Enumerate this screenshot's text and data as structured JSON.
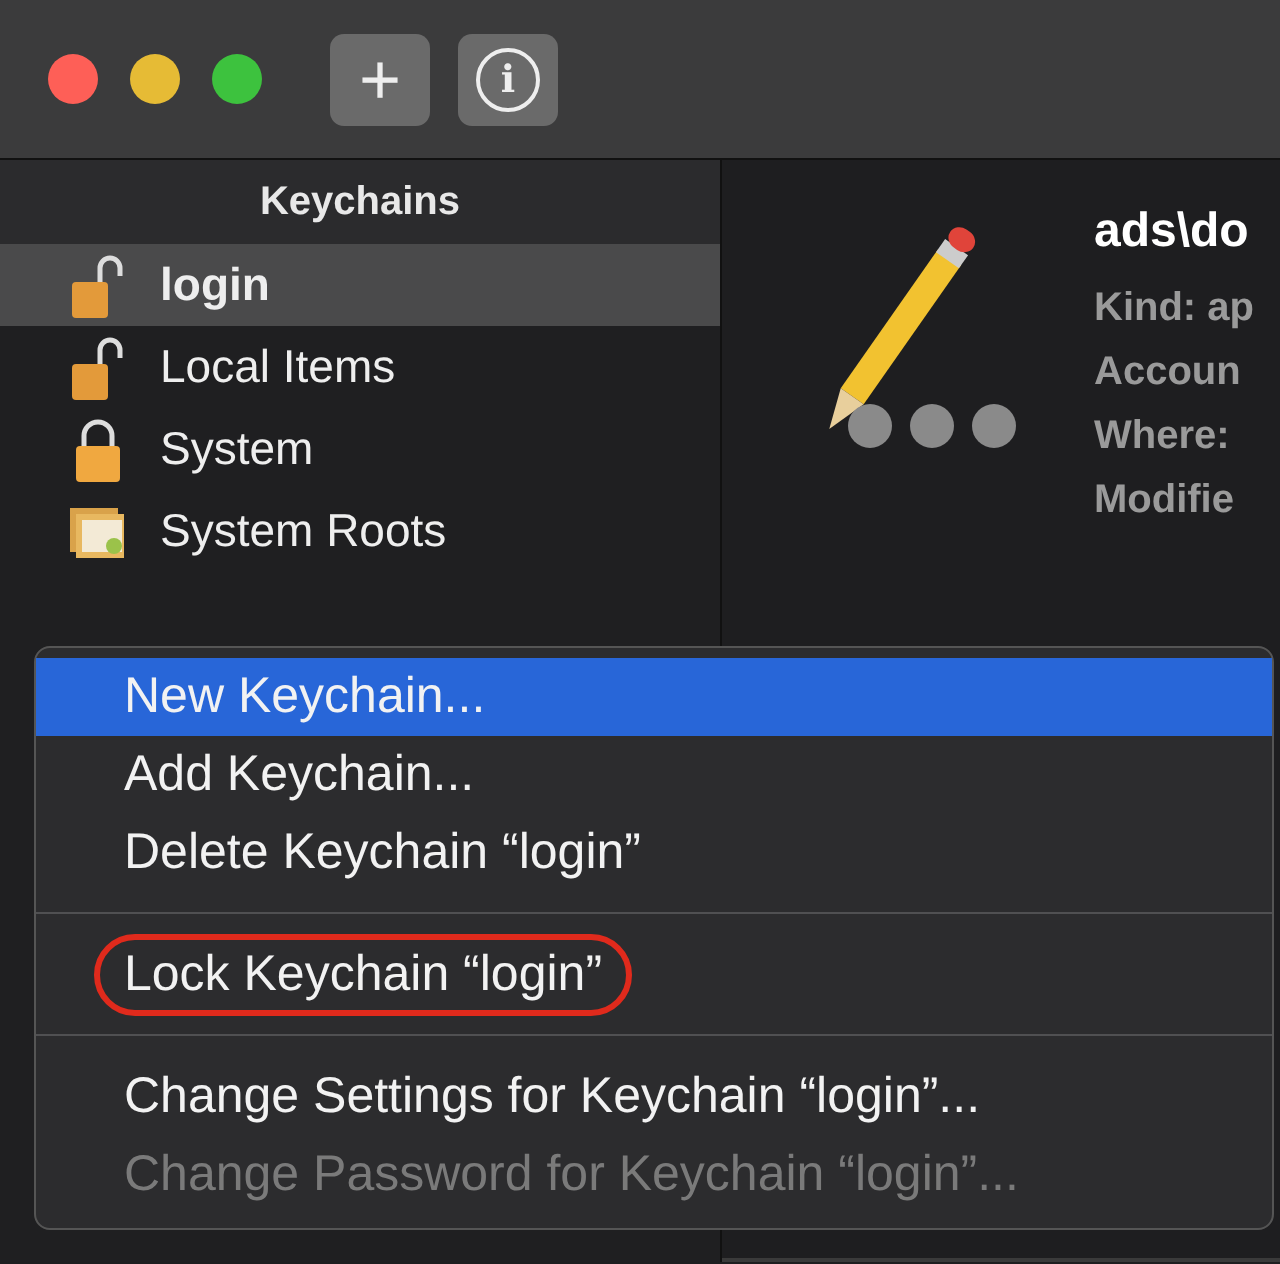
{
  "toolbar": {
    "buttons": [
      {
        "kind": "add",
        "label": "+"
      },
      {
        "kind": "info",
        "label": "i"
      }
    ]
  },
  "sidebar": {
    "header": "Keychains",
    "items": [
      {
        "label": "login",
        "kind": "unlocked",
        "selected": true
      },
      {
        "label": "Local Items",
        "kind": "unlocked",
        "selected": false
      },
      {
        "label": "System",
        "kind": "locked",
        "selected": false
      },
      {
        "label": "System Roots",
        "kind": "certificate",
        "selected": false
      }
    ]
  },
  "detail": {
    "title": "ads\\do",
    "fields": [
      "Kind:  ap",
      "Accoun",
      "Where:",
      "Modifie"
    ]
  },
  "context_menu": {
    "items": [
      {
        "kind": "item",
        "label": "New Keychain...",
        "selected": true,
        "disabled": false,
        "circled": false
      },
      {
        "kind": "item",
        "label": "Add Keychain...",
        "selected": false,
        "disabled": false,
        "circled": false
      },
      {
        "kind": "item",
        "label": "Delete Keychain “login”",
        "selected": false,
        "disabled": false,
        "circled": false
      },
      {
        "kind": "separator"
      },
      {
        "kind": "item",
        "label": "Lock Keychain “login”",
        "selected": false,
        "disabled": false,
        "circled": true
      },
      {
        "kind": "separator"
      },
      {
        "kind": "item",
        "label": "Change Settings for Keychain “login”...",
        "selected": false,
        "disabled": false,
        "circled": false
      },
      {
        "kind": "item",
        "label": "Change Password for Keychain “login”...",
        "selected": false,
        "disabled": true,
        "circled": false
      }
    ]
  }
}
